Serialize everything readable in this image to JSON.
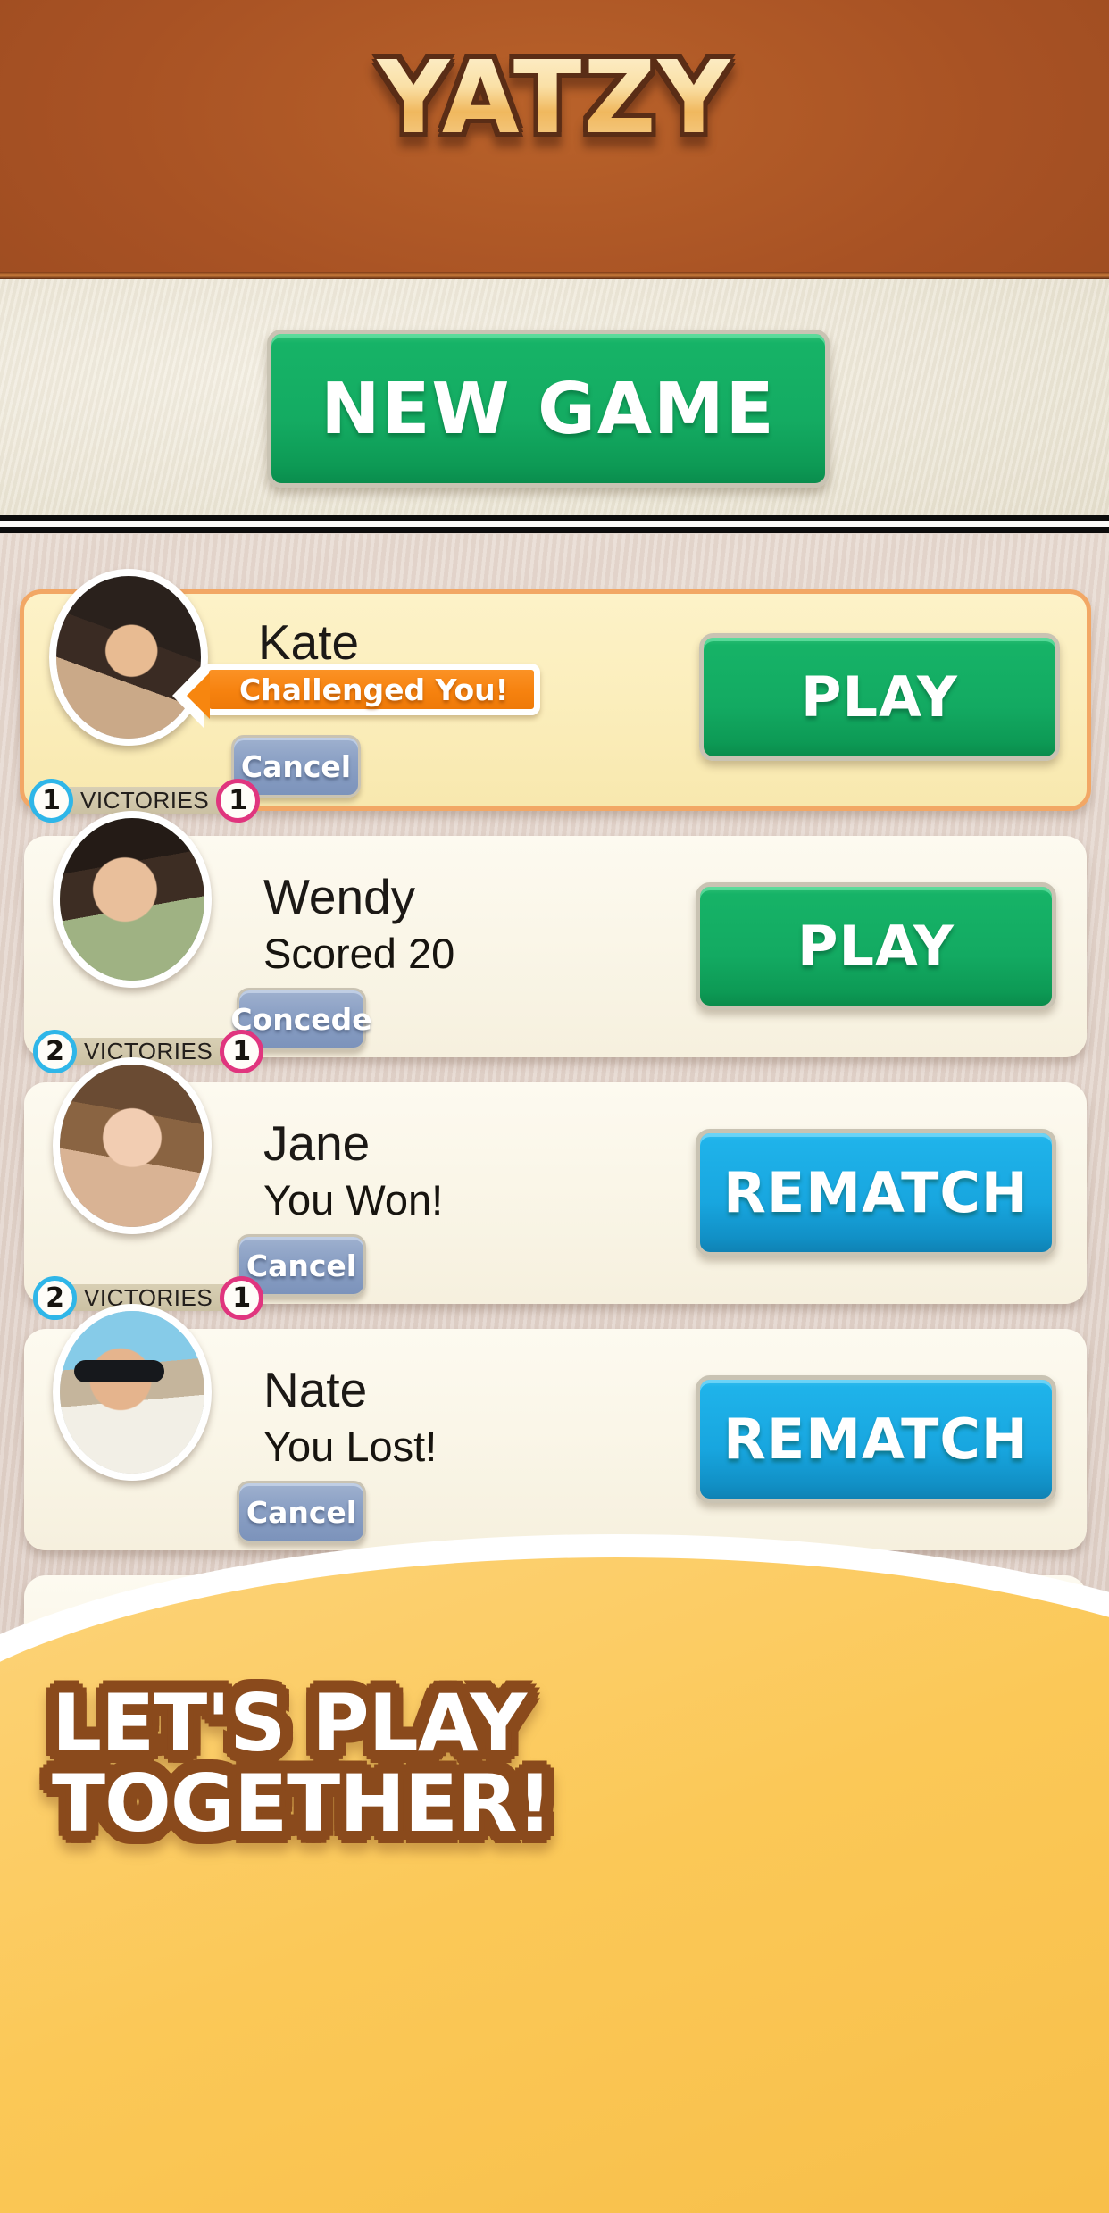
{
  "header": {
    "title": "YATZY",
    "bg_color": "#a85224",
    "title_color": "#f7d191"
  },
  "newgame": {
    "label": "NEW GAME",
    "color": "#13aa62"
  },
  "colors": {
    "green_button": "#13aa62",
    "blue_button": "#18a6df",
    "orange_accent": "#f6820f",
    "grey_button": "#8ca1c5",
    "victory_blue": "#2fb6e8",
    "victory_pink": "#e0357e",
    "banner_yellow": "#fbc857",
    "banner_outline": "#8a4a1c"
  },
  "victories_label": "VICTORIES",
  "games": [
    {
      "name": "Kate",
      "status": "",
      "bubble": "Challenged You!",
      "secondary_button": "Cancel",
      "action_button": "PLAY",
      "action_type": "green",
      "wins_mine": "1",
      "wins_theirs": "1",
      "highlighted": true,
      "avatar": "avatar-kate"
    },
    {
      "name": "Wendy",
      "status": "Scored 20",
      "bubble": "",
      "secondary_button": "Concede",
      "action_button": "PLAY",
      "action_type": "green",
      "wins_mine": "2",
      "wins_theirs": "1",
      "highlighted": false,
      "avatar": "avatar-wendy"
    },
    {
      "name": "Jane",
      "status": "You Won!",
      "bubble": "",
      "secondary_button": "Cancel",
      "action_button": "REMATCH",
      "action_type": "blue",
      "wins_mine": "2",
      "wins_theirs": "1",
      "highlighted": false,
      "avatar": "avatar-jane"
    },
    {
      "name": "Nate",
      "status": "You Lost!",
      "bubble": "",
      "secondary_button": "Cancel",
      "action_button": "REMATCH",
      "action_type": "blue",
      "wins_mine": "",
      "wins_theirs": "",
      "highlighted": false,
      "avatar": "avatar-nate"
    },
    {
      "name": "",
      "status": "",
      "bubble": "",
      "secondary_button": "",
      "action_button": "",
      "action_type": "blue",
      "wins_mine": "",
      "wins_theirs": "",
      "highlighted": false,
      "avatar": "avatar-five"
    }
  ],
  "banner": {
    "line1": "LET'S PLAY",
    "line2": "TOGETHER!"
  }
}
